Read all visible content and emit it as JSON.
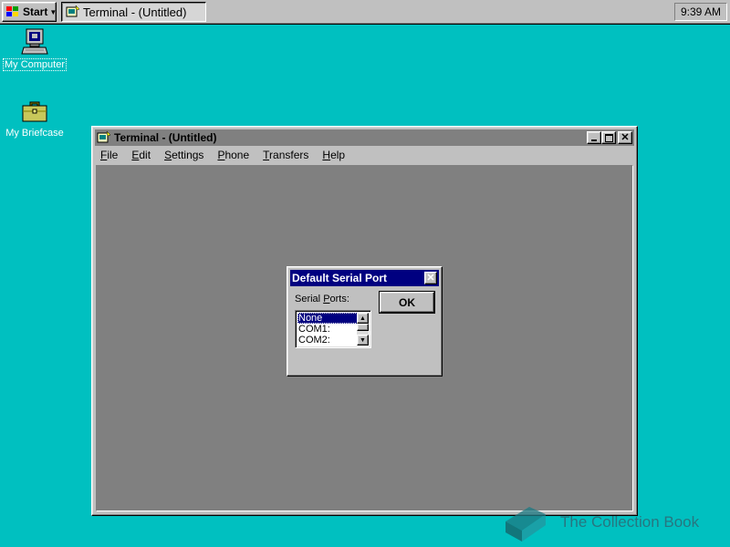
{
  "taskbar": {
    "start_label": "Start",
    "task_label": "Terminal - (Untitled)",
    "clock": "9:39 AM"
  },
  "desktop": {
    "icons": [
      {
        "label": "My Computer",
        "icon": "computer-icon"
      },
      {
        "label": "My Briefcase",
        "icon": "briefcase-icon"
      }
    ]
  },
  "window": {
    "title": "Terminal - (Untitled)",
    "menu": [
      {
        "label": "File",
        "underline": "F",
        "rest": "ile"
      },
      {
        "label": "Edit",
        "underline": "E",
        "rest": "dit"
      },
      {
        "label": "Settings",
        "underline": "S",
        "rest": "ettings"
      },
      {
        "label": "Phone",
        "underline": "P",
        "rest": "hone"
      },
      {
        "label": "Transfers",
        "underline": "T",
        "rest": "ransfers"
      },
      {
        "label": "Help",
        "underline": "H",
        "rest": "elp"
      }
    ]
  },
  "dialog": {
    "title": "Default Serial Port",
    "label_pre": "Serial ",
    "label_u": "P",
    "label_post": "orts:",
    "ok_label": "OK",
    "ports": [
      "None",
      "COM1:",
      "COM2:"
    ],
    "selected_port": "None"
  },
  "watermark": {
    "text": "The Collection Book"
  },
  "colors": {
    "desktop": "#00c0c0",
    "active_title": "#000080",
    "inactive_title": "#808080",
    "face": "#c0c0c0"
  }
}
